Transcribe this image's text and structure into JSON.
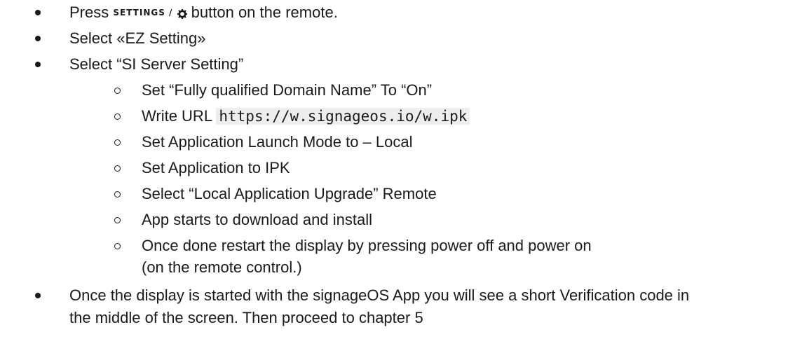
{
  "items": [
    {
      "pre": "Press",
      "key": "SETTINGS /",
      "post": "button on the remote."
    },
    {
      "text": "Select «EZ Setting»"
    },
    {
      "text": "Select “SI Server Setting”"
    }
  ],
  "subitems": [
    {
      "text": "Set “Fully qualified Domain Name” To “On”"
    },
    {
      "pre": "Write URL",
      "code": "https://w.signageos.io/w.ipk"
    },
    {
      "text": "Set Application Launch Mode to – Local"
    },
    {
      "text": "Set Application to IPK"
    },
    {
      "text": "Select “Local Application Upgrade” Remote"
    },
    {
      "text": "App starts to download and install"
    },
    {
      "line1": "Once done restart the display by pressing power off and power on",
      "line2": "(on the remote control.)"
    }
  ],
  "final": {
    "line1": "Once the display is started with the signageOS App you will see a short Verification code in",
    "line2": "the middle of the screen. Then proceed to chapter 5"
  },
  "icons": {
    "gear": "gear-icon"
  }
}
